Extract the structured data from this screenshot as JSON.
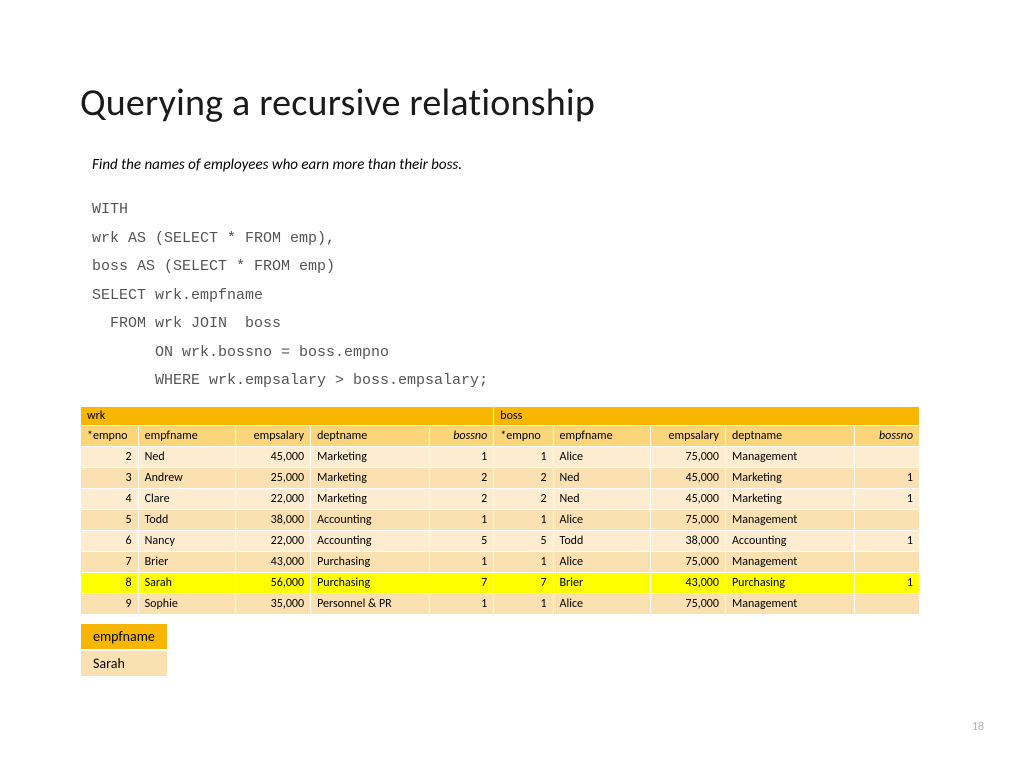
{
  "title": "Querying a recursive relationship",
  "prompt": "Find the names of employees who earn more than their boss.",
  "sql": "WITH\nwrk AS (SELECT * FROM emp),\nboss AS (SELECT * FROM emp)\nSELECT wrk.empfname\n  FROM wrk JOIN  boss\n       ON wrk.bossno = boss.empno\n       WHERE wrk.empsalary > boss.empsalary;",
  "table": {
    "group_left": "wrk",
    "group_right": "boss",
    "cols": {
      "c0": "*empno",
      "c1": "empfname",
      "c2": "empsalary",
      "c3": "deptname",
      "c4": "bossno",
      "c5": "*empno",
      "c6": "empfname",
      "c7": "empsalary",
      "c8": "deptname",
      "c9": "bossno"
    },
    "rows": [
      {
        "hl": false,
        "c0": "2",
        "c1": "Ned",
        "c2": "45,000",
        "c3": "Marketing",
        "c4": "1",
        "c5": "1",
        "c6": "Alice",
        "c7": "75,000",
        "c8": "Management",
        "c9": ""
      },
      {
        "hl": false,
        "c0": "3",
        "c1": "Andrew",
        "c2": "25,000",
        "c3": "Marketing",
        "c4": "2",
        "c5": "2",
        "c6": "Ned",
        "c7": "45,000",
        "c8": "Marketing",
        "c9": "1"
      },
      {
        "hl": false,
        "c0": "4",
        "c1": "Clare",
        "c2": "22,000",
        "c3": "Marketing",
        "c4": "2",
        "c5": "2",
        "c6": "Ned",
        "c7": "45,000",
        "c8": "Marketing",
        "c9": "1"
      },
      {
        "hl": false,
        "c0": "5",
        "c1": "Todd",
        "c2": "38,000",
        "c3": "Accounting",
        "c4": "1",
        "c5": "1",
        "c6": "Alice",
        "c7": "75,000",
        "c8": "Management",
        "c9": ""
      },
      {
        "hl": false,
        "c0": "6",
        "c1": "Nancy",
        "c2": "22,000",
        "c3": "Accounting",
        "c4": "5",
        "c5": "5",
        "c6": "Todd",
        "c7": "38,000",
        "c8": "Accounting",
        "c9": "1"
      },
      {
        "hl": false,
        "c0": "7",
        "c1": "Brier",
        "c2": "43,000",
        "c3": "Purchasing",
        "c4": "1",
        "c5": "1",
        "c6": "Alice",
        "c7": "75,000",
        "c8": "Management",
        "c9": ""
      },
      {
        "hl": true,
        "c0": "8",
        "c1": "Sarah",
        "c2": "56,000",
        "c3": "Purchasing",
        "c4": "7",
        "c5": "7",
        "c6": "Brier",
        "c7": "43,000",
        "c8": "Purchasing",
        "c9": "1"
      },
      {
        "hl": false,
        "c0": "9",
        "c1": "Sophie",
        "c2": "35,000",
        "c3": "Personnel & PR",
        "c4": "1",
        "c5": "1",
        "c6": "Alice",
        "c7": "75,000",
        "c8": "Management",
        "c9": ""
      }
    ]
  },
  "result": {
    "header": "empfname",
    "value": "Sarah"
  },
  "page": "18"
}
